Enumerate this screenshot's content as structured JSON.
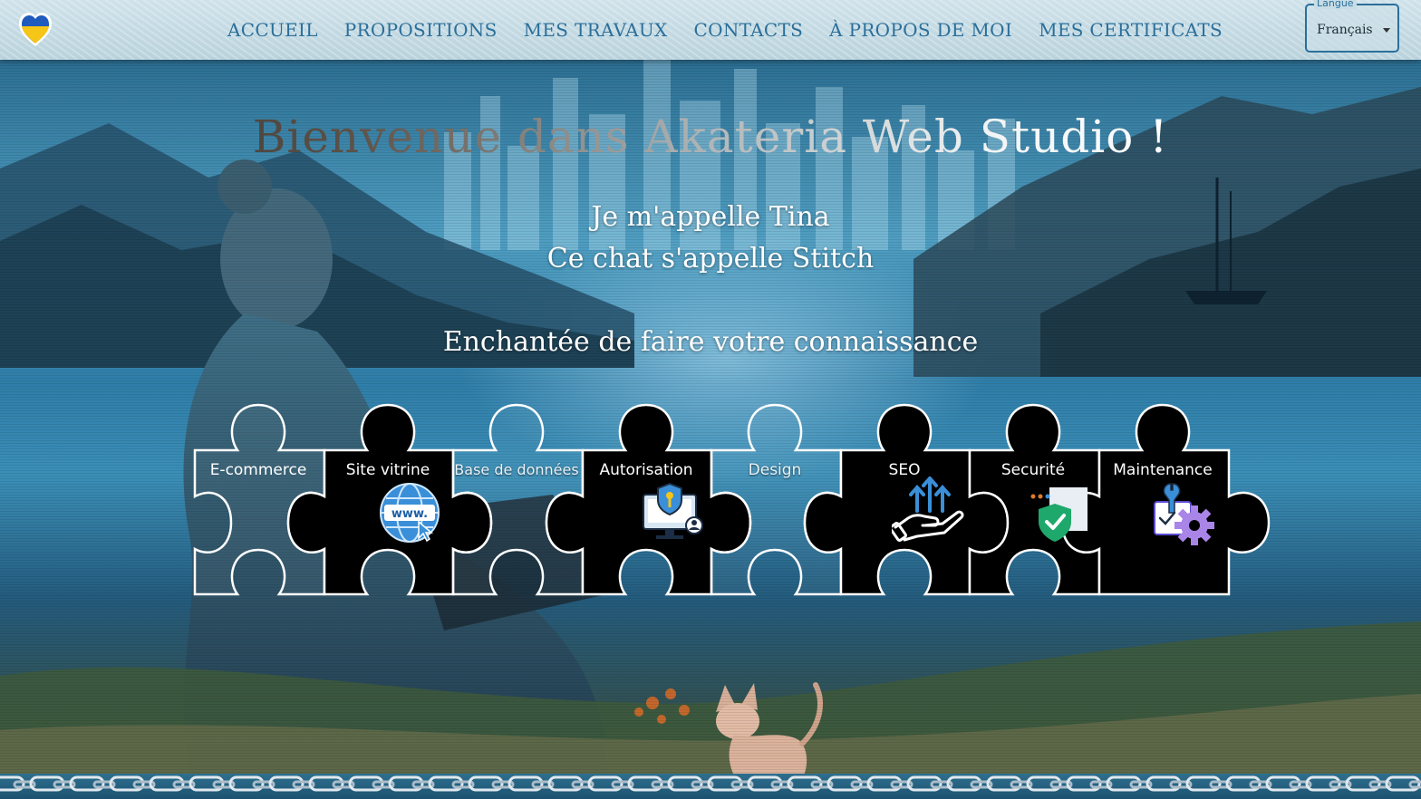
{
  "nav": {
    "items": [
      "ACCUEIL",
      "PROPOSITIONS",
      "MES TRAVAUX",
      "CONTACTS",
      "À PROPOS DE MOI",
      "MES CERTIFICATS"
    ]
  },
  "language": {
    "label": "Langue",
    "value": "Français"
  },
  "hero": {
    "title": "Bienvenue dans Akateria Web Studio !",
    "line1": "Je m'appelle Tina",
    "line2": "Ce chat s'appelle Stitch",
    "line3": "Enchantée de faire votre connaissance"
  },
  "services": [
    {
      "label": "E-commerce",
      "style": "outline",
      "icon": "none"
    },
    {
      "label": "Site vitrine",
      "style": "filled",
      "icon": "www-globe-icon"
    },
    {
      "label": "Base de données",
      "style": "outline",
      "icon": "none"
    },
    {
      "label": "Autorisation",
      "style": "filled",
      "icon": "security-computer-icon"
    },
    {
      "label": "Design",
      "style": "outline",
      "icon": "none"
    },
    {
      "label": "SEO",
      "style": "filled",
      "icon": "hand-arrows-icon"
    },
    {
      "label": "Securité",
      "style": "filled",
      "icon": "shield-check-icon"
    },
    {
      "label": "Maintenance",
      "style": "filled",
      "icon": "gear-tool-icon"
    }
  ],
  "colors": {
    "nav_link": "#2b6f9a",
    "piece_filled": "#000000",
    "piece_outline": "#ffffff"
  }
}
